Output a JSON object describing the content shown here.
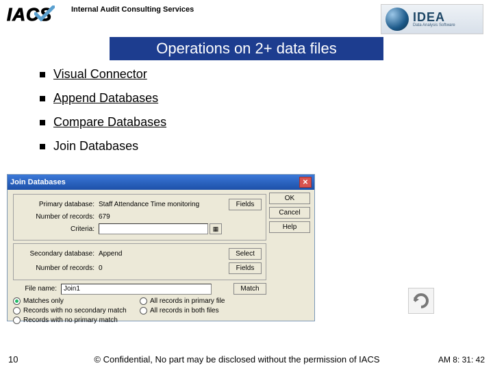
{
  "header": {
    "logo_text": "IACS",
    "subtitle": "Internal Audit Consulting Services",
    "idea_title": "IDEA",
    "idea_sub": "Data Analysis Software"
  },
  "title": "Operations on 2+ data files",
  "items": [
    {
      "label": "Visual Connector",
      "link": true
    },
    {
      "label": "Append Databases",
      "link": true
    },
    {
      "label": "Compare Databases",
      "link": true
    },
    {
      "label": "Join Databases",
      "link": false
    }
  ],
  "dialog": {
    "title": "Join Databases",
    "primary_lbl": "Primary database:",
    "primary_val": "Staff Attendance Time monitoring",
    "records_lbl": "Number of records:",
    "records_val": "679",
    "criteria_lbl": "Criteria:",
    "criteria_val": "",
    "secondary_lbl": "Secondary database:",
    "secondary_val": "Append",
    "sec_records_lbl": "Number of records:",
    "sec_records_val": "0",
    "filename_lbl": "File name:",
    "filename_val": "Join1",
    "buttons": {
      "ok": "OK",
      "cancel": "Cancel",
      "help": "Help",
      "fields": "Fields",
      "select": "Select",
      "fields2": "Fields",
      "match": "Match"
    },
    "radios": {
      "r1": "Matches only",
      "r2": "All records in primary file",
      "r3": "Records with no secondary match",
      "r4": "All records in both files",
      "r5": "Records with no primary match"
    }
  },
  "footer": {
    "page": "10",
    "copyright": "© Confidential, No part may be disclosed without the permission of IACS",
    "clock": "AM 8: 31: 42"
  }
}
